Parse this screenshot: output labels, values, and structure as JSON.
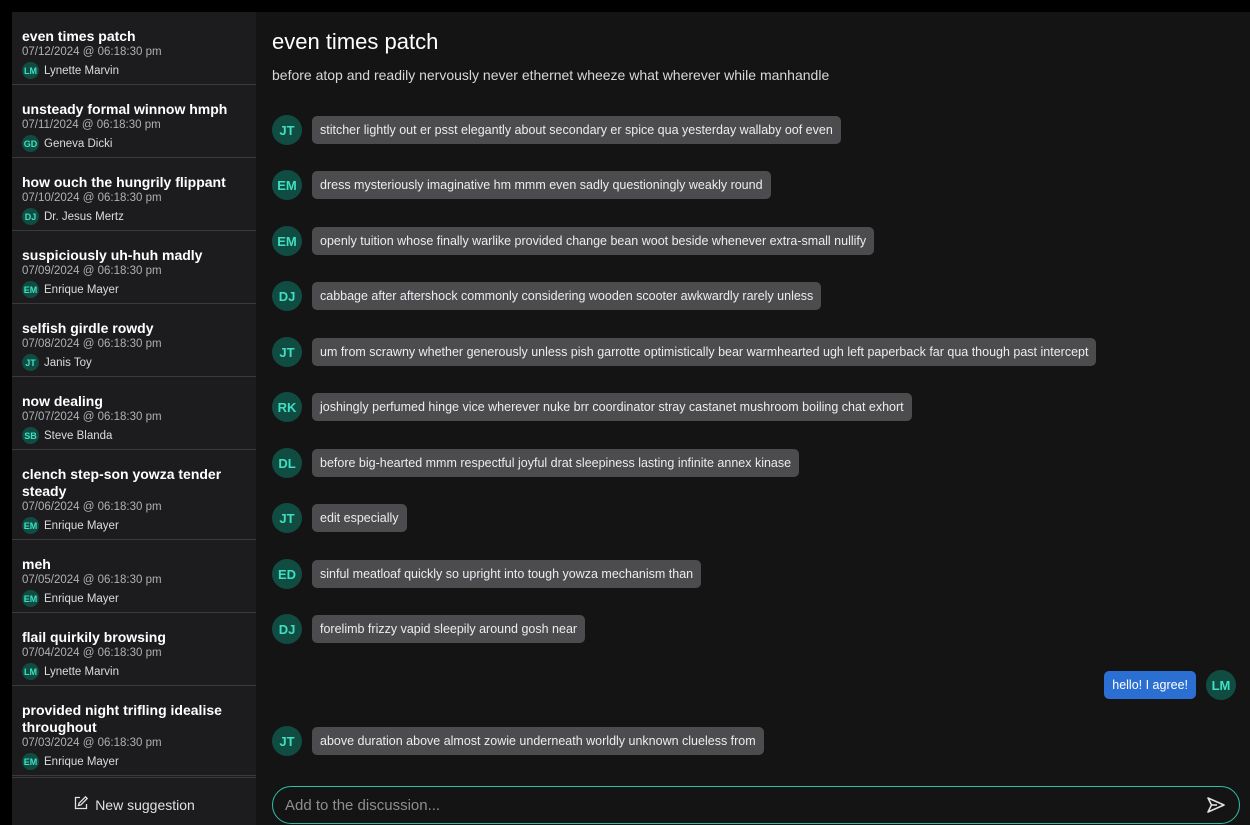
{
  "sidebar": {
    "threads": [
      {
        "title": "even times patch",
        "date": "07/12/2024 @ 06:18:30 pm",
        "initials": "LM",
        "author": "Lynette Marvin"
      },
      {
        "title": "unsteady formal winnow hmph",
        "date": "07/11/2024 @ 06:18:30 pm",
        "initials": "GD",
        "author": "Geneva Dicki"
      },
      {
        "title": "how ouch the hungrily flippant",
        "date": "07/10/2024 @ 06:18:30 pm",
        "initials": "DJ",
        "author": "Dr. Jesus Mertz"
      },
      {
        "title": "suspiciously uh-huh madly",
        "date": "07/09/2024 @ 06:18:30 pm",
        "initials": "EM",
        "author": "Enrique Mayer"
      },
      {
        "title": "selfish girdle rowdy",
        "date": "07/08/2024 @ 06:18:30 pm",
        "initials": "JT",
        "author": "Janis Toy"
      },
      {
        "title": "now dealing",
        "date": "07/07/2024 @ 06:18:30 pm",
        "initials": "SB",
        "author": "Steve Blanda"
      },
      {
        "title": "clench step-son yowza tender steady",
        "date": "07/06/2024 @ 06:18:30 pm",
        "initials": "EM",
        "author": "Enrique Mayer"
      },
      {
        "title": "meh",
        "date": "07/05/2024 @ 06:18:30 pm",
        "initials": "EM",
        "author": "Enrique Mayer"
      },
      {
        "title": "flail quirkily browsing",
        "date": "07/04/2024 @ 06:18:30 pm",
        "initials": "LM",
        "author": "Lynette Marvin"
      },
      {
        "title": "provided night trifling idealise throughout",
        "date": "07/03/2024 @ 06:18:30 pm",
        "initials": "EM",
        "author": "Enrique Mayer"
      }
    ],
    "new_suggestion_label": "New suggestion"
  },
  "main": {
    "title": "even times patch",
    "subtitle": "before atop and readily nervously never ethernet wheeze what wherever while manhandle",
    "messages": [
      {
        "initials": "JT",
        "text": "stitcher lightly out er psst elegantly about secondary er spice qua yesterday wallaby oof even",
        "self": false
      },
      {
        "initials": "EM",
        "text": "dress mysteriously imaginative hm mmm even sadly questioningly weakly round",
        "self": false
      },
      {
        "initials": "EM",
        "text": "openly tuition whose finally warlike provided change bean woot beside whenever extra-small nullify",
        "self": false
      },
      {
        "initials": "DJ",
        "text": "cabbage after aftershock commonly considering wooden scooter awkwardly rarely unless",
        "self": false
      },
      {
        "initials": "JT",
        "text": "um from scrawny whether generously unless pish garrotte optimistically bear warmhearted ugh left paperback far qua though past intercept",
        "self": false
      },
      {
        "initials": "RK",
        "text": "joshingly perfumed hinge vice wherever nuke brr coordinator stray castanet mushroom boiling chat exhort",
        "self": false
      },
      {
        "initials": "DL",
        "text": "before big-hearted mmm respectful joyful drat sleepiness lasting infinite annex kinase",
        "self": false
      },
      {
        "initials": "JT",
        "text": "edit especially",
        "self": false
      },
      {
        "initials": "ED",
        "text": "sinful meatloaf quickly so upright into tough yowza mechanism than",
        "self": false
      },
      {
        "initials": "DJ",
        "text": "forelimb frizzy vapid sleepily around gosh near",
        "self": false
      },
      {
        "initials": "LM",
        "text": "hello! I agree!",
        "self": true
      },
      {
        "initials": "JT",
        "text": "above duration above almost zowie underneath worldly unknown clueless from",
        "self": false
      }
    ]
  },
  "composer": {
    "placeholder": "Add to the discussion...",
    "value": ""
  },
  "icons": {
    "new_suggestion": "edit-note-icon",
    "send": "send-icon"
  },
  "colors": {
    "avatar_bg": "#114c43",
    "avatar_text": "#3fe0c2",
    "self_bubble": "#2a6fd1",
    "other_bubble": "#4c4c4f",
    "composer_border": "#2fbfa6"
  }
}
